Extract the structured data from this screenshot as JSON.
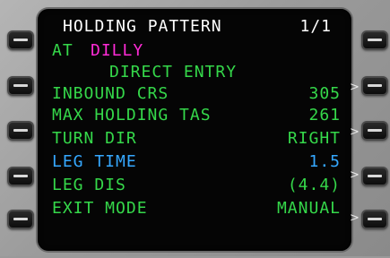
{
  "title": "HOLDING PATTERN",
  "page_indicator": "1/1",
  "at_prefix": "AT",
  "fix": "DILLY",
  "entry": "DIRECT ENTRY",
  "rows": [
    {
      "label": "INBOUND CRS",
      "value": "305"
    },
    {
      "label": "MAX HOLDING TAS",
      "value": "261"
    },
    {
      "label": "TURN DIR",
      "value": "RIGHT"
    },
    {
      "label": "LEG TIME",
      "value": "1.5"
    },
    {
      "label": "LEG DIS",
      "value": "(4.4)"
    },
    {
      "label": "EXIT MODE",
      "value": "MANUAL"
    }
  ],
  "caret_glyph": ">",
  "colors": {
    "title": "#ffffff",
    "green": "#35d84a",
    "magenta": "#ff2bd6",
    "cyan": "#35a8ff",
    "screen": "#050505"
  }
}
